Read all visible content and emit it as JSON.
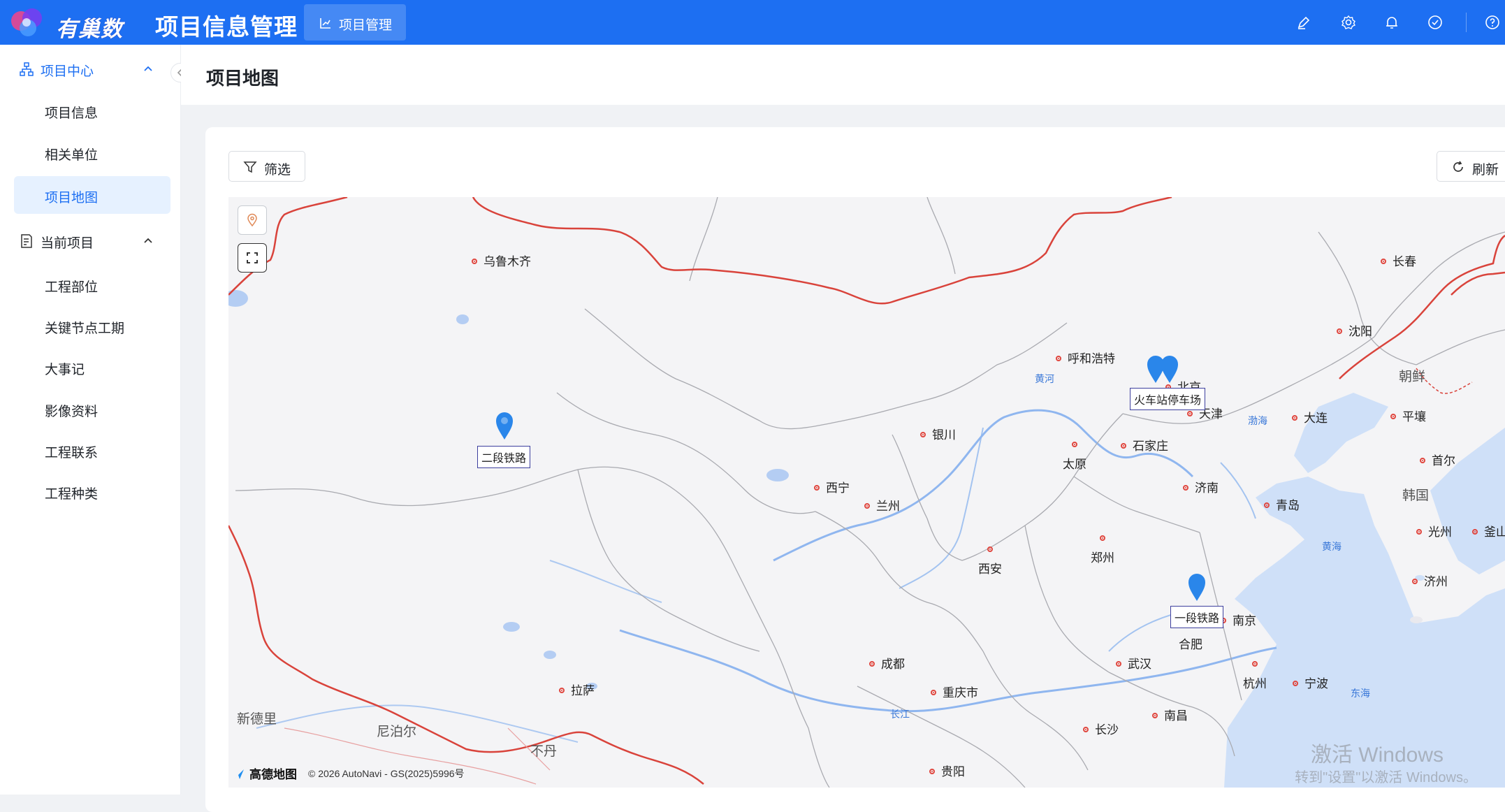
{
  "app": {
    "brand": "有巢数智",
    "title": "项目信息管理",
    "top_tab": "项目管理",
    "top_icons": [
      "edit-icon",
      "settings-icon",
      "bell-icon",
      "check-circle-icon",
      "help-icon"
    ]
  },
  "sidebar": {
    "groups": [
      {
        "label": "项目中心",
        "icon": "org-chart-icon",
        "expanded": true,
        "items": [
          {
            "label": "项目信息",
            "active": false
          },
          {
            "label": "相关单位",
            "active": false
          },
          {
            "label": "项目地图",
            "active": true
          }
        ]
      },
      {
        "label": "当前项目",
        "icon": "document-icon",
        "expanded": true,
        "items": [
          {
            "label": "工程部位",
            "active": false
          },
          {
            "label": "关键节点工期",
            "active": false
          },
          {
            "label": "大事记",
            "active": false
          },
          {
            "label": "影像资料",
            "active": false
          },
          {
            "label": "工程联系",
            "active": false
          },
          {
            "label": "工程种类",
            "active": false
          }
        ]
      }
    ]
  },
  "page": {
    "title": "项目地图",
    "filter_button": "筛选",
    "refresh_button": "刷新"
  },
  "map": {
    "cities": [
      {
        "name": "乌鲁木齐"
      },
      {
        "name": "呼和浩特"
      },
      {
        "name": "北京"
      },
      {
        "name": "天津"
      },
      {
        "name": "长春"
      },
      {
        "name": "沈阳"
      },
      {
        "name": "大连"
      },
      {
        "name": "平壤"
      },
      {
        "name": "首尔"
      },
      {
        "name": "光州"
      },
      {
        "name": "釜山"
      },
      {
        "name": "济州"
      },
      {
        "name": "银川"
      },
      {
        "name": "石家庄"
      },
      {
        "name": "太原"
      },
      {
        "name": "济南"
      },
      {
        "name": "青岛"
      },
      {
        "name": "西宁"
      },
      {
        "name": "兰州"
      },
      {
        "name": "西安"
      },
      {
        "name": "郑州"
      },
      {
        "name": "南京"
      },
      {
        "name": "合肥"
      },
      {
        "name": "成都"
      },
      {
        "name": "武汉"
      },
      {
        "name": "重庆市"
      },
      {
        "name": "杭州"
      },
      {
        "name": "宁波"
      },
      {
        "name": "拉萨"
      },
      {
        "name": "长沙"
      },
      {
        "name": "南昌"
      },
      {
        "name": "贵阳"
      }
    ],
    "water_labels": [
      "黄河",
      "渤海",
      "黄海",
      "东海",
      "长江"
    ],
    "country_labels": [
      "朝鲜",
      "韩国",
      "新德里",
      "尼泊尔",
      "不丹"
    ],
    "markers": [
      {
        "label": "二段铁路"
      },
      {
        "label": "火车站停车场"
      },
      {
        "label": "一段铁路"
      }
    ],
    "attribution_logo": "高德地图",
    "attribution_text": "© 2026 AutoNavi - GS(2025)5996号"
  },
  "watermark": {
    "line1": "激活 Windows",
    "line2": "转到\"设置\"以激活 Windows。"
  },
  "colors": {
    "topbar": "#1d6ff2",
    "active_menu_bg": "#e6f1ff",
    "accent": "#1d6ff2",
    "border_red": "#d9433b",
    "marker_blue": "#2a86ea"
  }
}
